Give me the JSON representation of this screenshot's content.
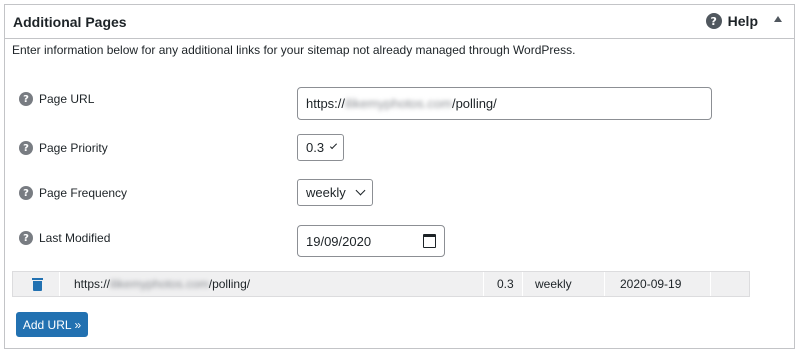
{
  "panel": {
    "title": "Additional Pages",
    "help_label": "Help",
    "intro": "Enter information below for any additional links for your sitemap not already managed through WordPress."
  },
  "form": {
    "page_url": {
      "label": "Page URL",
      "prefix": "https://",
      "blurred": "ilikemyphotos.com",
      "suffix": "/polling/"
    },
    "page_priority": {
      "label": "Page Priority",
      "value": "0.3"
    },
    "page_frequency": {
      "label": "Page Frequency",
      "value": "weekly"
    },
    "last_modified": {
      "label": "Last Modified",
      "value": "19/09/2020"
    }
  },
  "entries": [
    {
      "url_prefix": "https://",
      "url_blurred": "ilikemyphotos.com",
      "url_suffix": "/polling/",
      "priority": "0.3",
      "frequency": "weekly",
      "modified": "2020-09-19"
    }
  ],
  "actions": {
    "add_url": "Add URL »"
  },
  "icons": {
    "help": "question-circle-icon",
    "collapse": "triangle-up-icon",
    "delete": "trash-icon",
    "calendar": "calendar-icon"
  },
  "colors": {
    "accent": "#2271b1",
    "border": "#c3c4c7",
    "row_bg": "#f0f0f1"
  }
}
